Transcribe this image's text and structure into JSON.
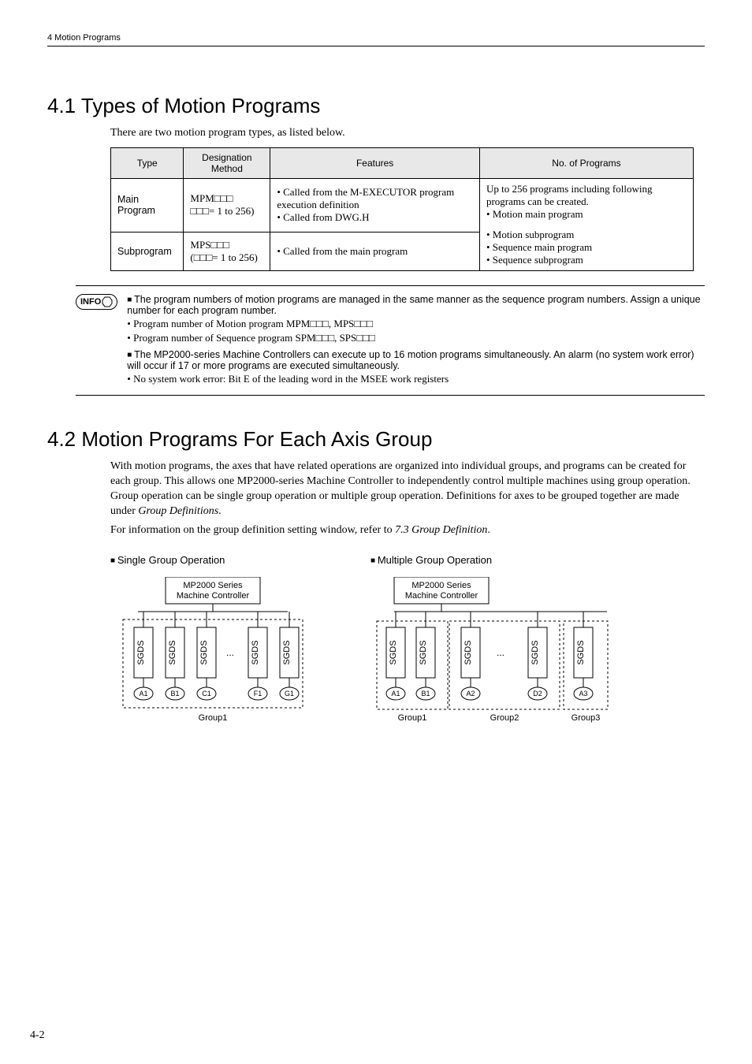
{
  "header": {
    "breadcrumb": "4  Motion Programs"
  },
  "section1": {
    "title": "4.1  Types of Motion Programs",
    "intro": "There are two motion program types, as listed below.",
    "table": {
      "headers": [
        "Type",
        "Designation Method",
        "Features",
        "No. of Programs"
      ],
      "rows": [
        {
          "type": "Main Program",
          "designation_l1": "MPM□□□",
          "designation_l2": "□□□= 1 to 256)",
          "features": "• Called from the M-EXECUTOR program execution definition\n• Called from DWG.H",
          "programs_top": "Up to 256 programs including following programs can be created.",
          "programs_item": "• Motion main program"
        },
        {
          "type": "Subprogram",
          "designation_l1": "MPS□□□",
          "designation_l2": "(□□□= 1 to 256)",
          "features": "• Called from the main program",
          "programs_items": "• Motion subprogram\n• Sequence main program\n• Sequence subprogram"
        }
      ]
    }
  },
  "info": {
    "label": "INFO",
    "b1": "The program numbers of motion programs are managed in the same manner as the sequence program numbers. Assign a unique number for each program number.",
    "b1_sub1": "Program number of Motion program MPM□□□, MPS□□□",
    "b1_sub2": "Program number of Sequence program SPM□□□, SPS□□□",
    "b2": "The MP2000-series Machine Controllers can execute up to 16 motion programs simultaneously. An alarm (no system work error) will occur if 17 or more programs are executed simultaneously.",
    "b2_sub1": "No system work error: Bit E of the leading word in the MSEE work registers"
  },
  "section2": {
    "title": "4.2  Motion Programs For Each Axis Group",
    "p1": "With motion programs, the axes that have related operations are organized into individual groups, and programs can be created for each group. This allows one MP2000-series Machine Controller to independently control multiple machines using group operation. Group operation can be single group operation or multiple group operation. Definitions for axes to be grouped together are made under",
    "p1_em": "Group Definitions",
    "p1_end": ".",
    "p2_a": "For information on the group definition setting window, refer to ",
    "p2_em": "7.3 Group Definition",
    "p2_end": "."
  },
  "diagrams": {
    "single": {
      "title": "Single Group Operation",
      "controller_l1": "MP2000 Series",
      "controller_l2": "Machine Controller",
      "sgds": "SGDS",
      "ellipsis": "...",
      "axes": [
        "A1",
        "B1",
        "C1",
        "F1",
        "G1"
      ],
      "group": "Group1"
    },
    "multiple": {
      "title": "Multiple Group Operation",
      "controller_l1": "MP2000 Series",
      "controller_l2": "Machine Controller",
      "sgds": "SGDS",
      "ellipsis": "...",
      "groups": [
        {
          "label": "Group1",
          "axes": [
            "A1",
            "B1"
          ]
        },
        {
          "label": "Group2",
          "axes": [
            "A2",
            "D2"
          ]
        },
        {
          "label": "Group3",
          "axes": [
            "A3"
          ]
        }
      ]
    }
  },
  "page_num": "4-2"
}
